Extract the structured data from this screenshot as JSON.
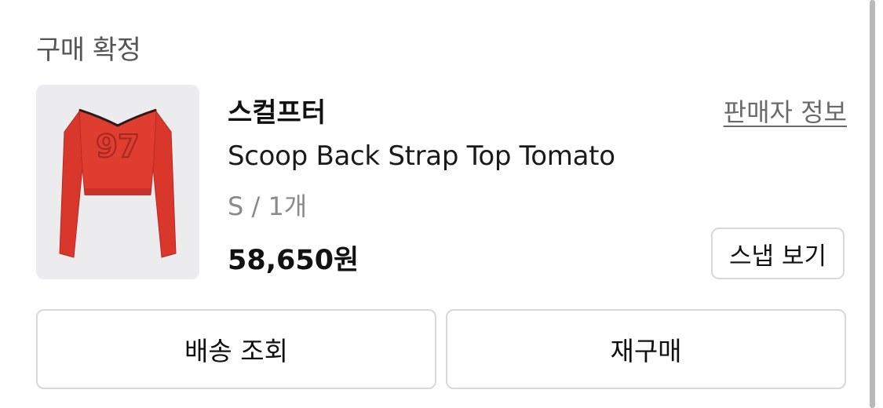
{
  "order": {
    "status": "구매 확정"
  },
  "product": {
    "brand": "스컬프터",
    "seller_info_label": "판매자 정보",
    "name": "Scoop Back Strap Top Tomato",
    "option": "S / 1개",
    "price": "58,650원",
    "snap_button_label": "스냅 보기",
    "image_icon": "red-long-sleeve-top",
    "image_bg_color": "#ececee",
    "garment_color": "#d9372c"
  },
  "actions": {
    "track_delivery_label": "배송 조회",
    "rebuy_label": "재구매"
  }
}
